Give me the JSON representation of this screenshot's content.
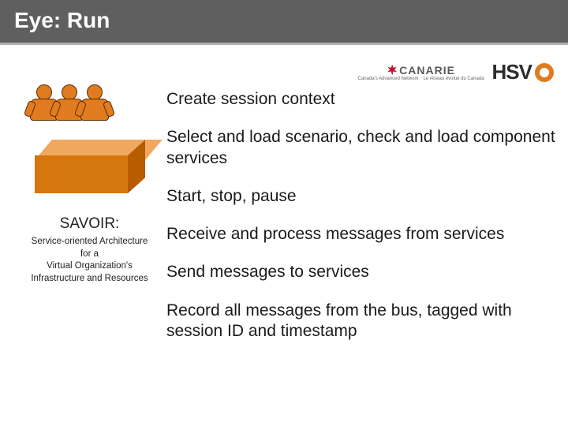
{
  "title": "Eye: Run",
  "logos": {
    "canarie": {
      "name": "CANARIE",
      "tag_left": "Canada's Advanced Network",
      "tag_right": "Le réseau évolué du Canada"
    },
    "hsvo": {
      "name": "HSV"
    }
  },
  "savoir": {
    "title": "SAVOIR:",
    "line1": "Service-oriented Architecture",
    "line2": "for a",
    "line3": "Virtual Organization's",
    "line4": "Infrastructure and Resources"
  },
  "bullets": [
    "Create session context",
    "Select and load scenario, check and load component services",
    "Start, stop, pause",
    "Receive and process messages from services",
    "Send messages to services",
    "Record all messages from the bus, tagged with session ID and timestamp"
  ]
}
